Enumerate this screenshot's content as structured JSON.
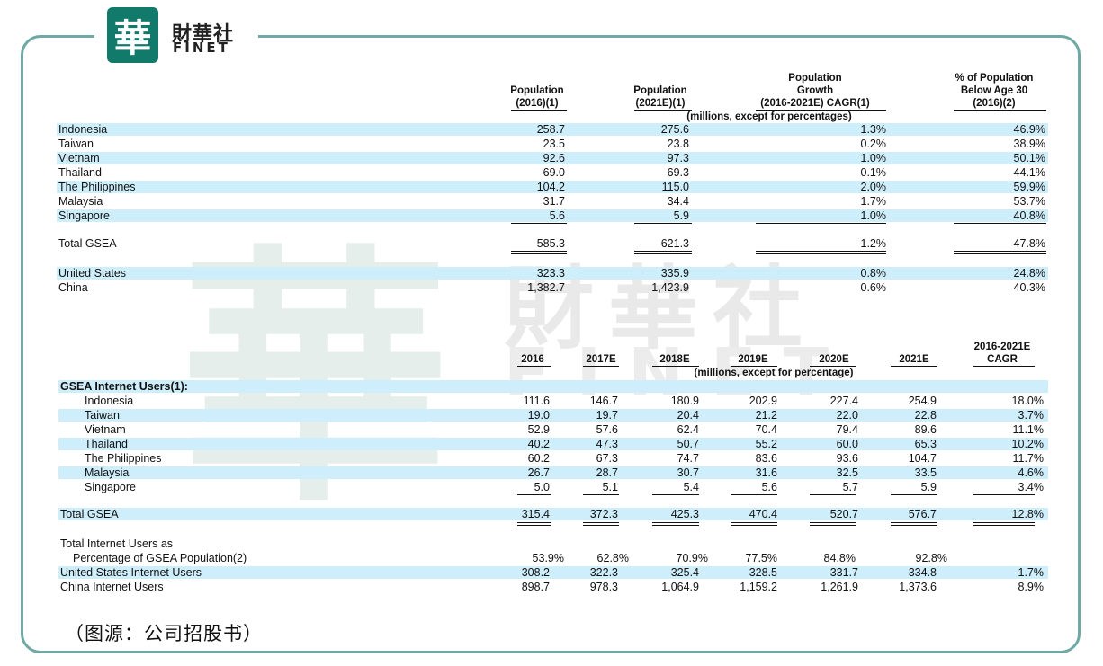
{
  "brand": {
    "logo_char": "華",
    "name_cn": "財華社",
    "name_en": "FINET"
  },
  "watermark": {
    "char": "華",
    "cn": "財華社",
    "en": "FINET"
  },
  "population_table": {
    "headers": [
      "Population\n(2016)(1)",
      "Population\n(2021E)(1)",
      "Population\nGrowth\n(2016-2021E)  CAGR(1)",
      "% of Population\nBelow Age 30\n(2016)(2)"
    ],
    "units_note": "(millions, except for percentages)",
    "rows": [
      [
        "Indonesia",
        "258.7",
        "275.6",
        "1.3%",
        "46.9%"
      ],
      [
        "Taiwan",
        "23.5",
        "23.8",
        "0.2%",
        "38.9%"
      ],
      [
        "Vietnam",
        "92.6",
        "97.3",
        "1.0%",
        "50.1%"
      ],
      [
        "Thailand",
        "69.0",
        "69.3",
        "0.1%",
        "44.1%"
      ],
      [
        "The Philippines",
        "104.2",
        "115.0",
        "2.0%",
        "59.9%"
      ],
      [
        "Malaysia",
        "31.7",
        "34.4",
        "1.7%",
        "53.7%"
      ],
      [
        "Singapore",
        "5.6",
        "5.9",
        "1.0%",
        "40.8%"
      ]
    ],
    "total": [
      "Total GSEA",
      "585.3",
      "621.3",
      "1.2%",
      "47.8%"
    ],
    "others": [
      [
        "United States",
        "323.3",
        "335.9",
        "0.8%",
        "24.8%"
      ],
      [
        "China",
        "1,382.7",
        "1,423.9",
        "0.6%",
        "40.3%"
      ]
    ]
  },
  "internet_table": {
    "headers": [
      "2016",
      "2017E",
      "2018E",
      "2019E",
      "2020E",
      "2021E",
      "2016-2021E\nCAGR"
    ],
    "units_note": "(millions, except for percentage)",
    "section_label": "GSEA Internet Users(1):",
    "rows": [
      [
        "Indonesia",
        "111.6",
        "146.7",
        "180.9",
        "202.9",
        "227.4",
        "254.9",
        "18.0%"
      ],
      [
        "Taiwan",
        "19.0",
        "19.7",
        "20.4",
        "21.2",
        "22.0",
        "22.8",
        "3.7%"
      ],
      [
        "Vietnam",
        "52.9",
        "57.6",
        "62.4",
        "70.4",
        "79.4",
        "89.6",
        "11.1%"
      ],
      [
        "Thailand",
        "40.2",
        "47.3",
        "50.7",
        "55.2",
        "60.0",
        "65.3",
        "10.2%"
      ],
      [
        "The Philippines",
        "60.2",
        "67.3",
        "74.7",
        "83.6",
        "93.6",
        "104.7",
        "11.7%"
      ],
      [
        "Malaysia",
        "26.7",
        "28.7",
        "30.7",
        "31.6",
        "32.5",
        "33.5",
        "4.6%"
      ],
      [
        "Singapore",
        "5.0",
        "5.1",
        "5.4",
        "5.6",
        "5.7",
        "5.9",
        "3.4%"
      ]
    ],
    "total": [
      "Total GSEA",
      "315.4",
      "372.3",
      "425.3",
      "470.4",
      "520.7",
      "576.7",
      "12.8%"
    ],
    "pct_label_1": "Total Internet Users as",
    "pct_label_2": "Percentage of GSEA Population(2)",
    "pct_values": [
      "53.9%",
      "62.8%",
      "70.9%",
      "77.5%",
      "84.8%",
      "92.8%"
    ],
    "others": [
      [
        "United States Internet Users",
        "308.2",
        "322.3",
        "325.4",
        "328.5",
        "331.7",
        "334.8",
        "1.7%"
      ],
      [
        "China Internet Users",
        "898.7",
        "978.3",
        "1,064.9",
        "1,159.2",
        "1,261.9",
        "1,373.6",
        "8.9%"
      ]
    ]
  },
  "source_note": "（图源：公司招股书）",
  "colors": {
    "frame": "#6fa8a4",
    "logo": "#127a6a",
    "band": "#cdeefa"
  }
}
